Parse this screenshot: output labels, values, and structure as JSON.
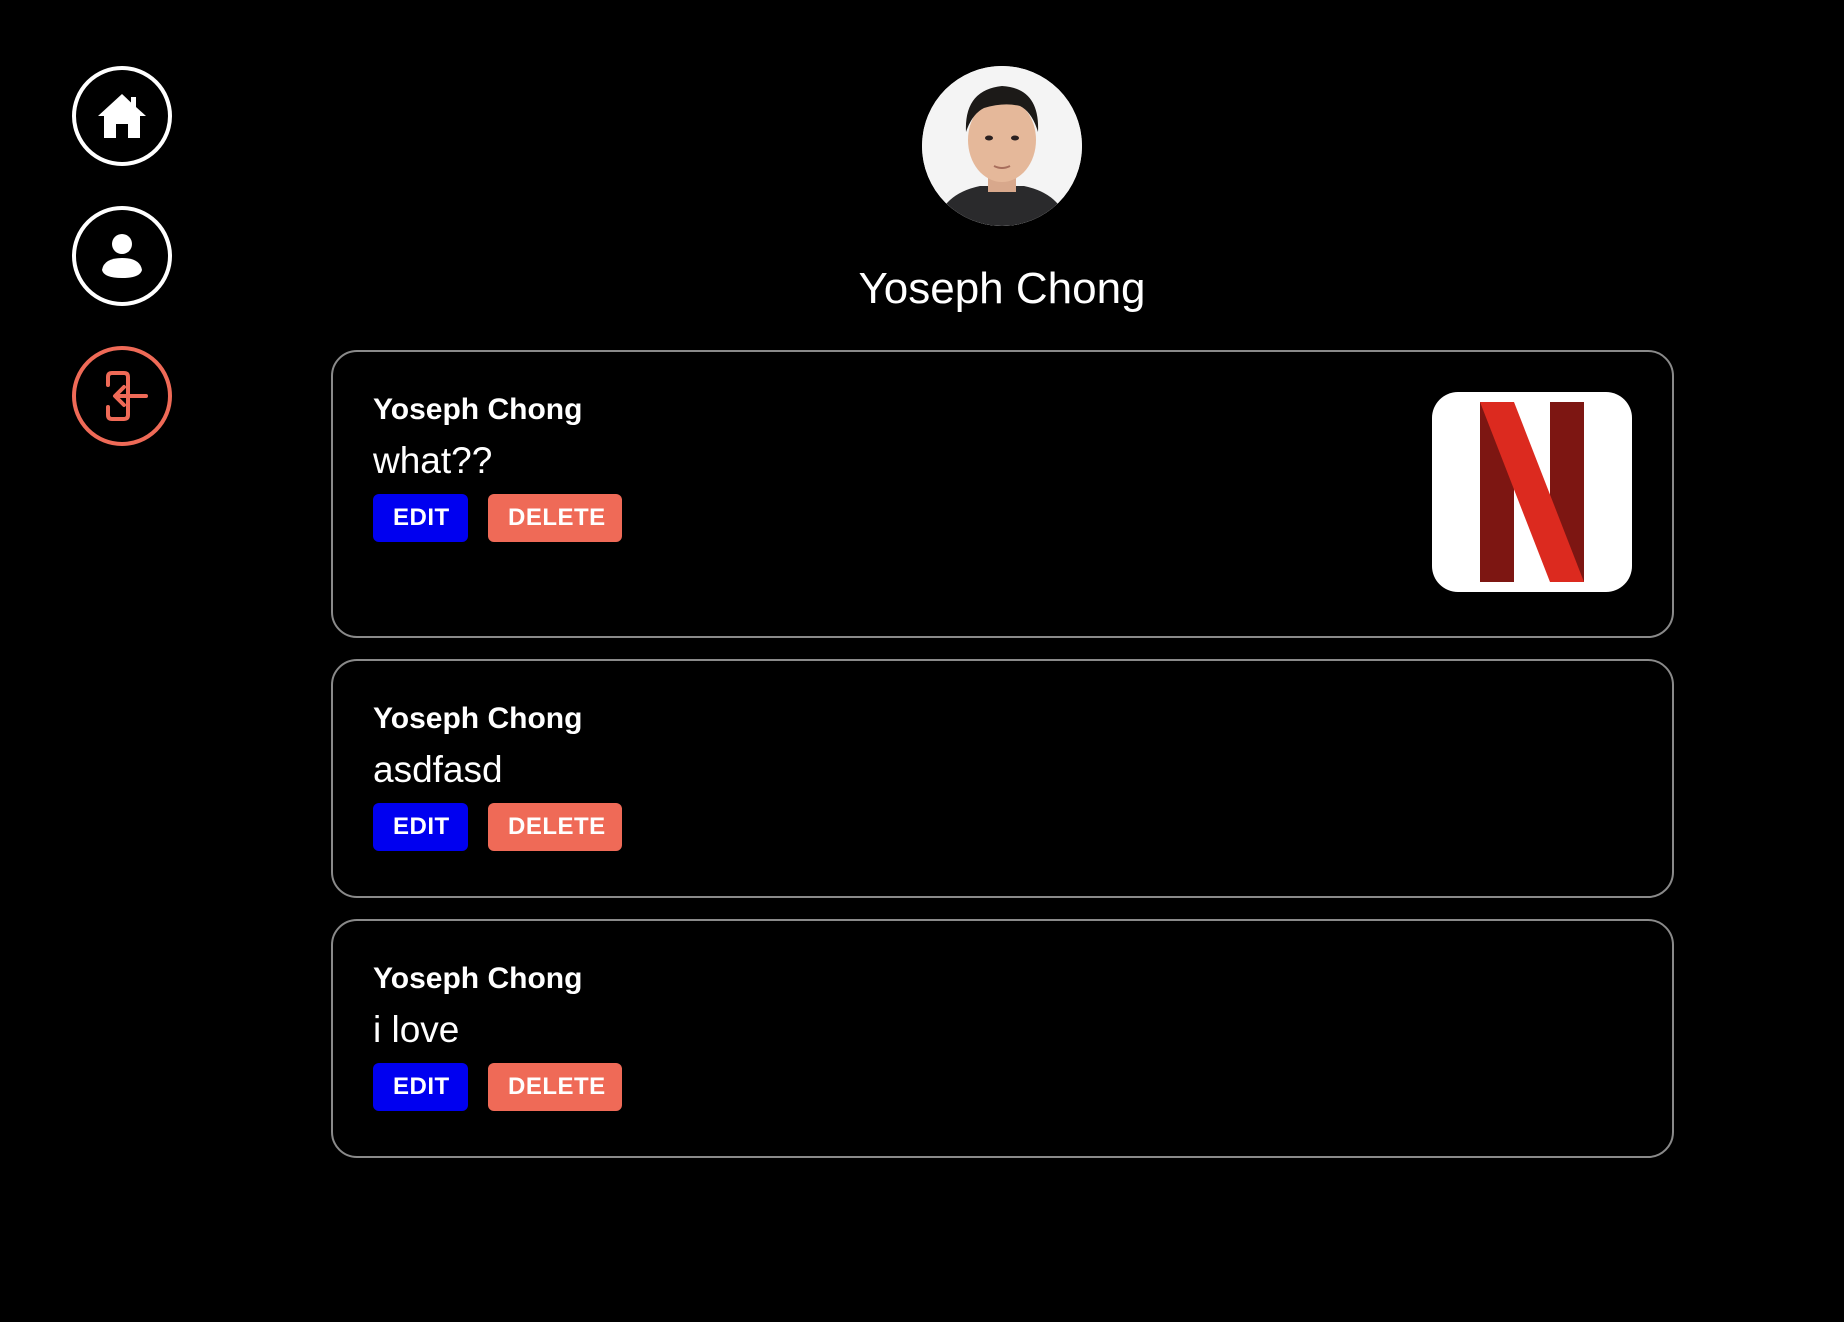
{
  "sidebar": {
    "items": [
      {
        "name": "home",
        "icon": "home-icon"
      },
      {
        "name": "profile",
        "icon": "user-icon"
      },
      {
        "name": "logout",
        "icon": "logout-icon",
        "color": "#ef6a57"
      }
    ]
  },
  "profile": {
    "name": "Yoseph Chong",
    "avatar_icon": "avatar-photo"
  },
  "posts": [
    {
      "author": "Yoseph Chong",
      "text": "what??",
      "edit_label": "EDIT",
      "delete_label": "DELETE",
      "image_icon": "netflix-logo"
    },
    {
      "author": "Yoseph Chong",
      "text": "asdfasd",
      "edit_label": "EDIT",
      "delete_label": "DELETE"
    },
    {
      "author": "Yoseph Chong",
      "text": "i love",
      "edit_label": "EDIT",
      "delete_label": "DELETE"
    }
  ],
  "colors": {
    "background": "#000000",
    "edit": "#0000f0",
    "delete": "#ef6a57",
    "card_border": "#8a8a8a"
  }
}
